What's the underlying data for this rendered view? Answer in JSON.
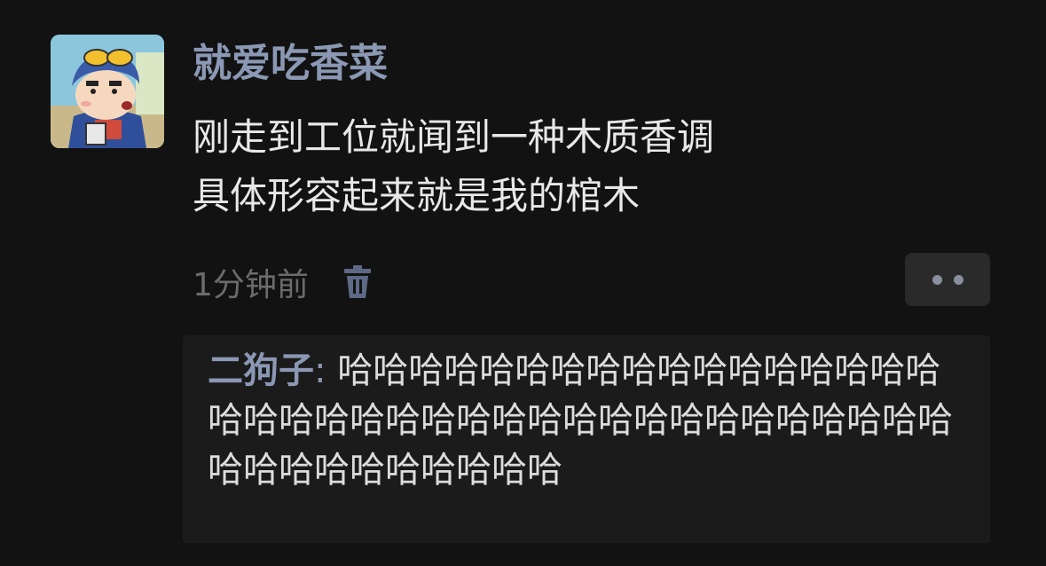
{
  "post": {
    "username": "就爱吃香菜",
    "content_lines": [
      "刚走到工位就闻到一种木质香调",
      "具体形容起来就是我的棺木"
    ],
    "timestamp": "1分钟前",
    "delete_icon": "trash-icon",
    "more_icon": "more-dots-icon"
  },
  "comments": [
    {
      "author": "二狗子",
      "separator": ": ",
      "text": "哈哈哈哈哈哈哈哈哈哈哈哈哈哈哈哈哈哈哈哈哈哈哈哈哈哈哈哈哈哈哈哈哈哈哈哈哈哈哈哈哈哈哈哈哈哈哈哈"
    }
  ],
  "colors": {
    "background": "#121212",
    "username": "#8b98b4",
    "text": "#e8e8e8",
    "muted": "#6b6b6b",
    "comment_bg": "#1b1b1b"
  }
}
